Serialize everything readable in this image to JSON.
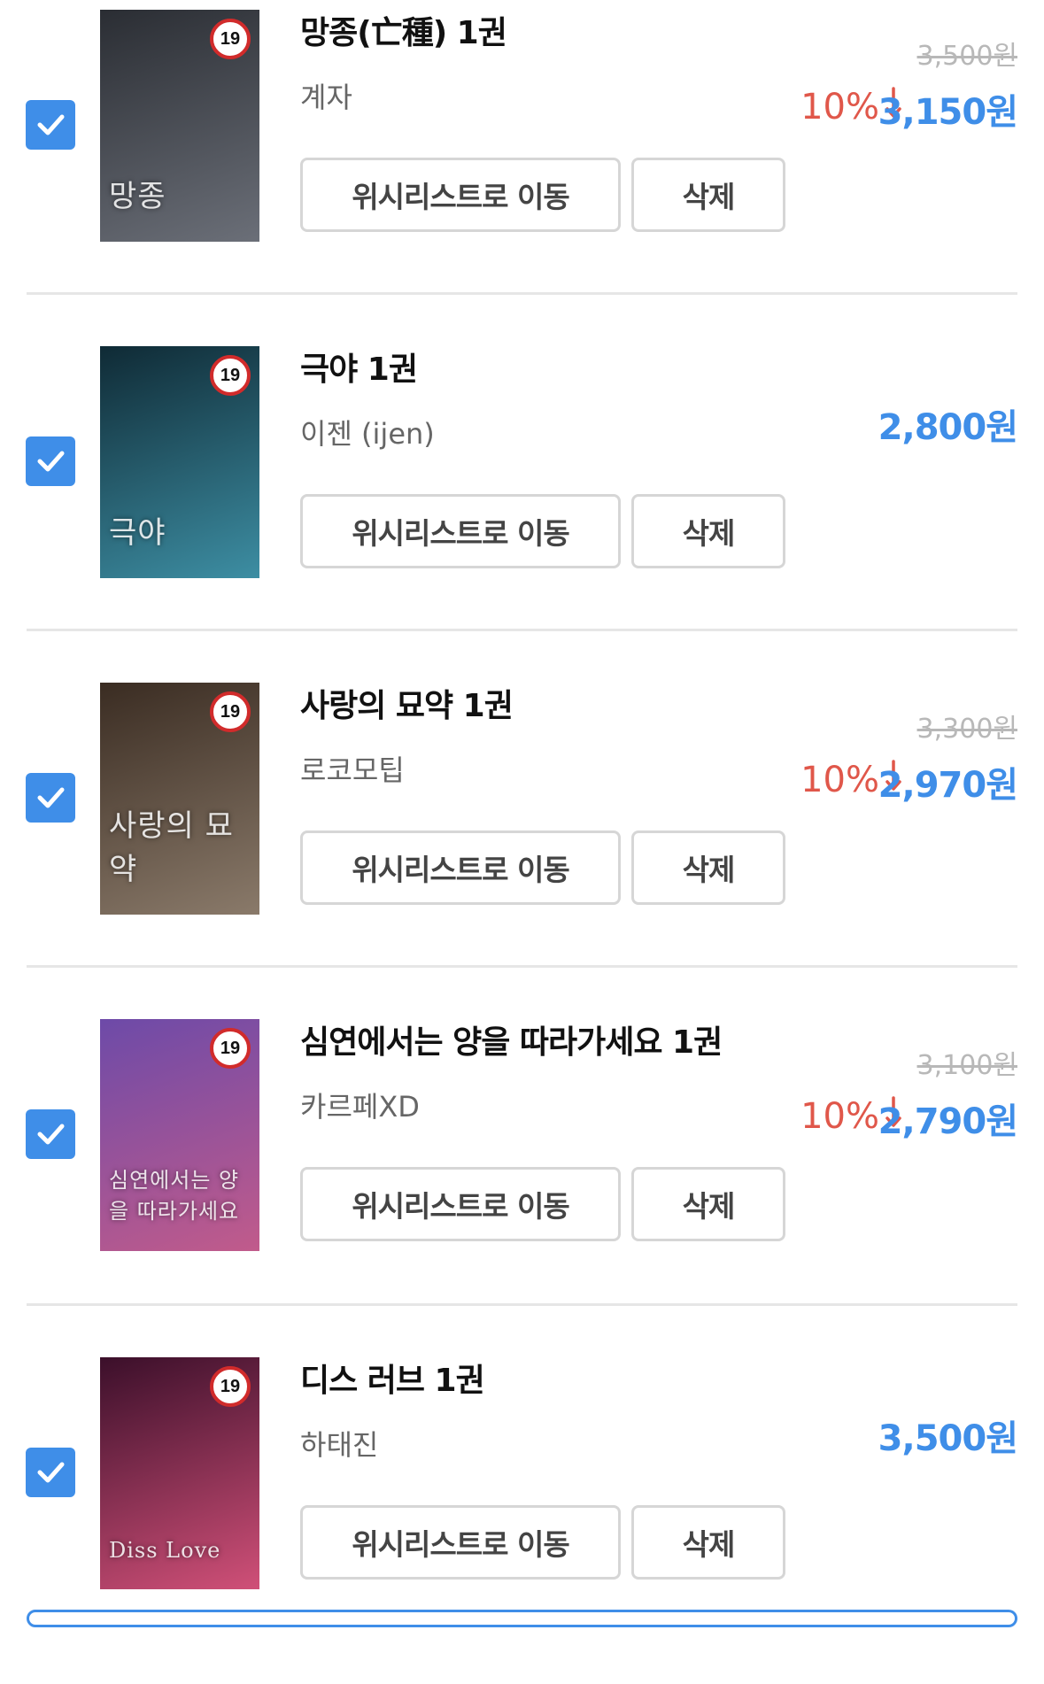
{
  "cart": {
    "items": [
      {
        "title": "망종(亡種) 1권",
        "author": "계자",
        "original_price": "3,500원",
        "discount": "10%",
        "price": "3,150원",
        "checked": true,
        "cover_title": "망종",
        "age_rating": "19",
        "cover_colors": [
          "#2a2d33",
          "#6b6f78"
        ]
      },
      {
        "title": "극야 1권",
        "author": "이젠 (ijen)",
        "original_price": "",
        "discount": "",
        "price": "2,800원",
        "checked": true,
        "cover_title": "극야",
        "age_rating": "19",
        "cover_colors": [
          "#0f2a35",
          "#3d8ea3"
        ]
      },
      {
        "title": "사랑의 묘약 1권",
        "author": "로코모팁",
        "original_price": "3,300원",
        "discount": "10%",
        "price": "2,970원",
        "checked": true,
        "cover_title": "사랑의 묘약",
        "age_rating": "19",
        "cover_colors": [
          "#3a2c22",
          "#8a7a6a"
        ]
      },
      {
        "title": "심연에서는 양을 따라가세요 1권",
        "author": "카르페XD",
        "original_price": "3,100원",
        "discount": "10%",
        "price": "2,790원",
        "checked": true,
        "cover_title": "심연에서는 양을 따라가세요",
        "age_rating": "19",
        "cover_colors": [
          "#6d4aa8",
          "#c15b8b"
        ]
      },
      {
        "title": "디스 러브 1권",
        "author": "하태진",
        "original_price": "",
        "discount": "",
        "price": "3,500원",
        "checked": true,
        "cover_title": "Diss Love",
        "age_rating": "19",
        "cover_colors": [
          "#3b0f2a",
          "#d05078"
        ]
      }
    ],
    "wishlist_label": "위시리스트로 이동",
    "delete_label": "삭제"
  },
  "colors": {
    "accent": "#3f8ee8",
    "discount": "#e0574a",
    "divider": "#e6e6e6"
  }
}
